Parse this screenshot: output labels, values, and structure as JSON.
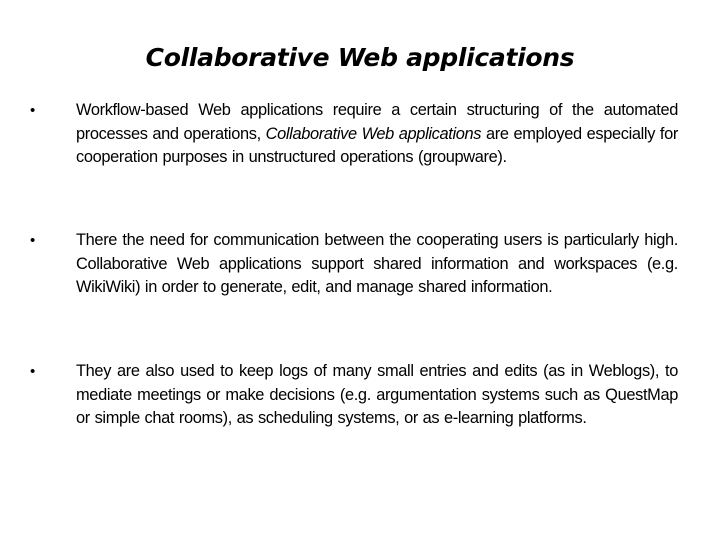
{
  "slide": {
    "title": "Collaborative Web applications",
    "bullets": [
      {
        "icon": "bullet-dot",
        "glyph": "•",
        "text_before": "Workflow-based Web applications require a certain structuring of the automated processes and operations, ",
        "emphasis": "Collaborative Web applications",
        "text_after": " are employed especially for cooperation purposes in unstructured operations (groupware)."
      },
      {
        "icon": "bullet-dot",
        "glyph": "•",
        "text_before": "There the need for communication between the cooperating users is particularly high. Collaborative Web applications support shared information and workspaces (e.g. WikiWiki) in order to generate, edit, and manage shared information.",
        "emphasis": "",
        "text_after": ""
      },
      {
        "icon": "bullet-dot",
        "glyph": "•",
        "text_before": "They are also used to keep logs of many small entries and edits (as in Weblogs), to mediate meetings or make decisions (e.g. argumentation systems such as QuestMap or simple chat rooms), as scheduling systems, or as e-learning platforms.",
        "emphasis": "",
        "text_after": ""
      }
    ]
  }
}
